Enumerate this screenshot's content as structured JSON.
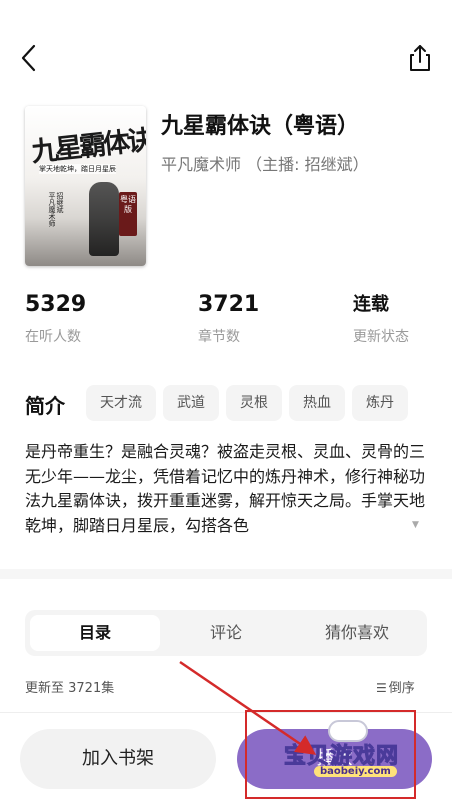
{
  "header": {
    "back_icon": "chevron-left-icon",
    "share_icon": "share-icon"
  },
  "book": {
    "title": "九星霸体诀（粤语）",
    "author_line": "平凡魔术师 （主播: 招继斌）",
    "cover": {
      "title": "九星霸体诀",
      "subtitle": "掌天地乾坤，踏日月星辰",
      "badge": "粤语版",
      "author": "平凡魔术师",
      "anchor": "招继斌"
    }
  },
  "stats": [
    {
      "value": "5329",
      "label": "在听人数"
    },
    {
      "value": "3721",
      "label": "章节数"
    },
    {
      "value": "连载",
      "label": "更新状态"
    }
  ],
  "intro": {
    "heading": "简介",
    "tags": [
      "天才流",
      "武道",
      "灵根",
      "热血",
      "炼丹"
    ],
    "description": "是丹帝重生？是融合灵魂？被盗走灵根、灵血、灵骨的三无少年——龙尘，凭借着记忆中的炼丹神术，修行神秘功法九星霸体诀，拨开重重迷雾，解开惊天之局。手掌天地乾坤，脚踏日月星辰，勾搭各色",
    "more_icon": "triangle-down-icon"
  },
  "tabs": [
    {
      "label": "目录",
      "active": true
    },
    {
      "label": "评论",
      "active": false
    },
    {
      "label": "猜你喜欢",
      "active": false
    }
  ],
  "catalog": {
    "update_text": "更新至 3721集",
    "sort_label": "倒序",
    "sort_icon": "sort-icon"
  },
  "bottom": {
    "shelf_label": "加入书架",
    "play_label": "播放"
  },
  "watermark": {
    "text": "宝贝游戏网",
    "url": "baobeiy.com"
  },
  "colors": {
    "accent": "#8b6cc7",
    "annotation": "#d42a2a"
  }
}
